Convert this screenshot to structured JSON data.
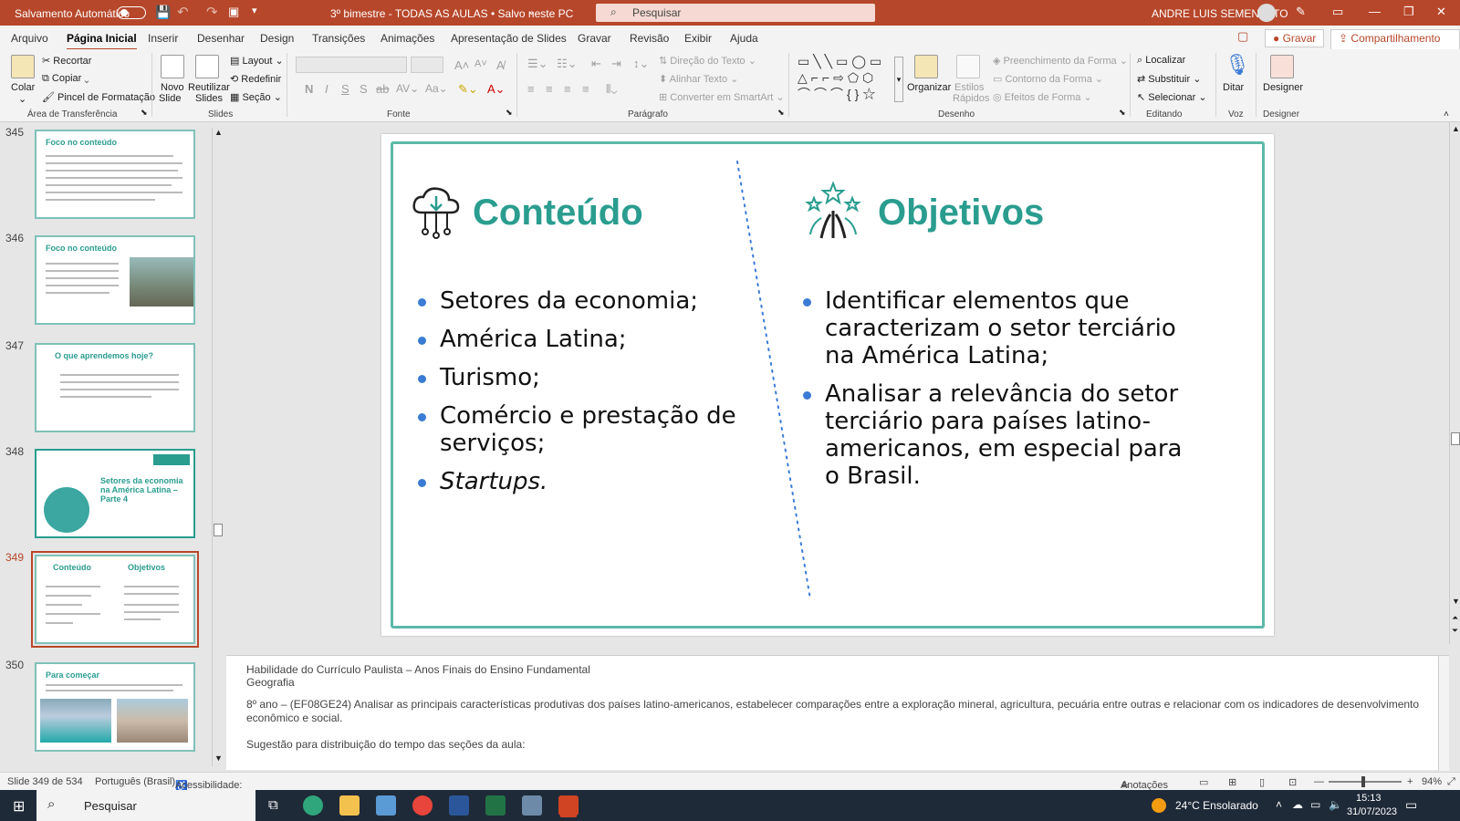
{
  "titlebar": {
    "autosave_label": "Salvamento Automático",
    "doc_title": "3º bimestre - TODAS AS AULAS • Salvo neste PC",
    "search_placeholder": "Pesquisar",
    "user": "ANDRE LUIS SEMENSATO"
  },
  "menu": [
    "Arquivo",
    "Página Inicial",
    "Inserir",
    "Desenhar",
    "Design",
    "Transições",
    "Animações",
    "Apresentação de Slides",
    "Gravar",
    "Revisão",
    "Exibir",
    "Ajuda"
  ],
  "menu_right": {
    "record": "Gravar",
    "share": "Compartilhamento"
  },
  "ribbon": {
    "clipboard": {
      "paste": "Colar",
      "cut": "Recortar",
      "copy": "Copiar",
      "format_painter": "Pincel de Formatação",
      "group": "Área de Transferência"
    },
    "slides": {
      "new_slide": "Novo",
      "new_slide2": "Slide",
      "reuse": "Reutilizar",
      "reuse2": "Slides",
      "layout": "Layout",
      "reset": "Redefinir",
      "section": "Seção",
      "group": "Slides"
    },
    "font": {
      "group": "Fonte"
    },
    "paragraph": {
      "text_direction": "Direção do Texto",
      "align_text": "Alinhar Texto",
      "smartart": "Converter em SmartArt",
      "group": "Parágrafo"
    },
    "drawing": {
      "arrange": "Organizar",
      "quick_styles": "Estilos",
      "quick_styles2": "Rápidos",
      "shape_fill": "Preenchimento da Forma",
      "shape_outline": "Contorno da Forma",
      "shape_effects": "Efeitos de Forma",
      "group": "Desenho"
    },
    "editing": {
      "find": "Localizar",
      "replace": "Substituir",
      "select": "Selecionar",
      "group": "Editando"
    },
    "voice": {
      "dictate": "Ditar",
      "group": "Voz"
    },
    "designer": {
      "label": "Designer",
      "group": "Designer"
    }
  },
  "thumbnails": [
    {
      "num": "345",
      "title": "Foco no conteúdo"
    },
    {
      "num": "346",
      "title": "Foco no conteúdo"
    },
    {
      "num": "347",
      "title": "O que aprendemos hoje?"
    },
    {
      "num": "348",
      "title": "Setores da economia na América Latina – Parte 4"
    },
    {
      "num": "349",
      "title": "Conteúdo"
    },
    {
      "num": "350",
      "title": "Para começar"
    }
  ],
  "slide": {
    "left_title": "Conteúdo",
    "left_items": [
      "Setores da economia;",
      "América Latina;",
      "Turismo;",
      "Comércio e prestação de serviços;",
      "Startups."
    ],
    "right_title": "Objetivos",
    "right_items": [
      "Identificar elementos que caracterizam o setor terciário na América Latina;",
      "Analisar a relevância do setor terciário para países latino-americanos, em especial para o Brasil."
    ]
  },
  "notes": {
    "line1": "Habilidade do Currículo Paulista – Anos Finais do Ensino Fundamental",
    "line2": "Geografia",
    "line3": "8º ano – (EF08GE24) Analisar as principais características produtivas dos países latino-americanos, estabelecer comparações entre a exploração mineral, agricultura, pecuária entre outras e relacionar com os indicadores de desenvolvimento econômico e social.",
    "line4": "Sugestão para distribuição do tempo das seções da aula:"
  },
  "status": {
    "slide_count": "Slide 349 de 534",
    "language": "Português (Brasil)",
    "accessibility": "Acessibilidade: investigar",
    "notes": "Anotações",
    "zoom": "94%"
  },
  "taskbar": {
    "search": "Pesquisar",
    "weather": "24°C  Ensolarado",
    "time": "15:13",
    "date": "31/07/2023"
  },
  "colors": {
    "accent": "#b7472a",
    "teal": "#2a9d8f"
  }
}
